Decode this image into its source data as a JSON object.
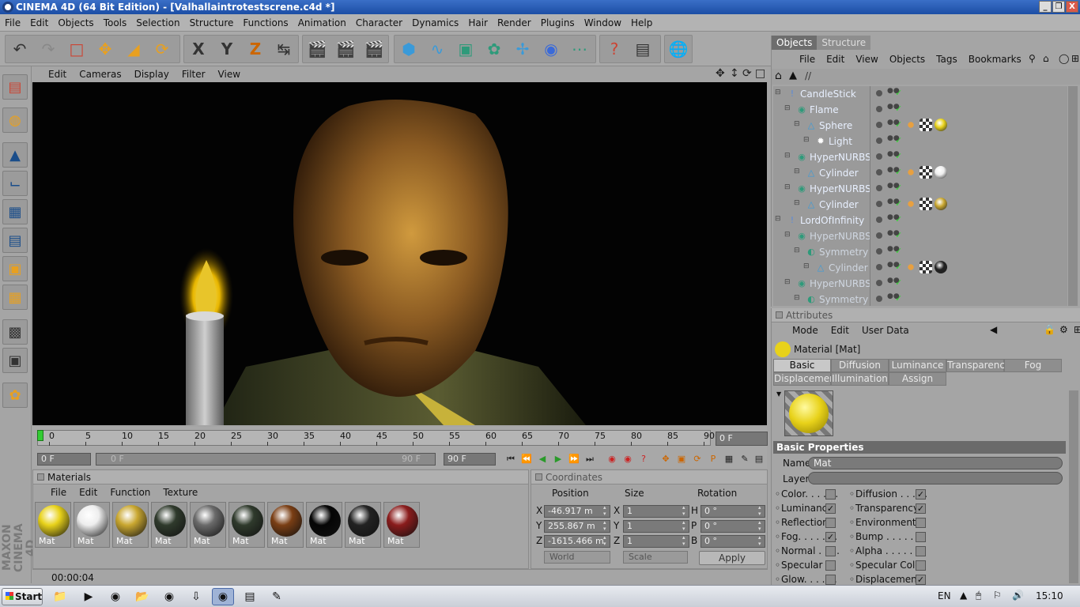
{
  "window": {
    "title": "CINEMA 4D (64 Bit Edition) - [Valhallaintrotestscrene.c4d *]",
    "min": "_",
    "restore": "❐",
    "close": "X"
  },
  "menu": [
    "File",
    "Edit",
    "Objects",
    "Tools",
    "Selection",
    "Structure",
    "Functions",
    "Animation",
    "Character",
    "Dynamics",
    "Hair",
    "Render",
    "Plugins",
    "Window",
    "Help"
  ],
  "toolbar": {
    "x_label": "X",
    "y_label": "Y",
    "z_label": "Z"
  },
  "viewport": {
    "menu": [
      "Edit",
      "Cameras",
      "Display",
      "Filter",
      "View"
    ]
  },
  "timeline": {
    "ticks": [
      "0",
      "5",
      "10",
      "15",
      "20",
      "25",
      "30",
      "35",
      "40",
      "45",
      "50",
      "55",
      "60",
      "65",
      "70",
      "75",
      "80",
      "85",
      "90"
    ],
    "current_frame": "0 F",
    "start_field": "0 F",
    "range_start": "0 F",
    "range_end": "90 F",
    "end_field": "90 F"
  },
  "materials": {
    "title": "Materials",
    "menu": [
      "File",
      "Edit",
      "Function",
      "Texture"
    ],
    "items": [
      {
        "label": "Mat",
        "color": "#e8d21a"
      },
      {
        "label": "Mat",
        "color": "#eeeeee"
      },
      {
        "label": "Mat",
        "color": "#c9a730"
      },
      {
        "label": "Mat",
        "color": "#2f3a2c"
      },
      {
        "label": "Mat",
        "color": "#6a6a6a"
      },
      {
        "label": "Mat",
        "color": "#2f3a2c"
      },
      {
        "label": "Mat",
        "color": "#7a3e14"
      },
      {
        "label": "Mat",
        "color": "#050505"
      },
      {
        "label": "Mat",
        "color": "#222222"
      },
      {
        "label": "Mat",
        "color": "#8a1c1c"
      }
    ]
  },
  "coordinates": {
    "title": "Coordinates",
    "headers": [
      "Position",
      "Size",
      "Rotation"
    ],
    "rows": [
      {
        "axis": "X",
        "pos": "-46.917 m",
        "saxis": "X",
        "size": "1",
        "raxis": "H",
        "rot": "0 °"
      },
      {
        "axis": "Y",
        "pos": "255.867 m",
        "saxis": "Y",
        "size": "1",
        "raxis": "P",
        "rot": "0 °"
      },
      {
        "axis": "Z",
        "pos": "-1615.466 m",
        "saxis": "Z",
        "size": "1",
        "raxis": "B",
        "rot": "0 °"
      }
    ],
    "mode": "World",
    "scale": "Scale",
    "apply": "Apply"
  },
  "status": {
    "time": "00:00:04"
  },
  "objects": {
    "tabs": [
      "Objects",
      "Structure"
    ],
    "menu": [
      "File",
      "Edit",
      "View",
      "Objects",
      "Tags",
      "Bookmarks"
    ],
    "path": "//",
    "rows": [
      {
        "name": "CandleStick",
        "indent": 0,
        "icon": "null",
        "dim": false,
        "tags": []
      },
      {
        "name": "Flame",
        "indent": 1,
        "icon": "nurbs",
        "dim": false,
        "tags": []
      },
      {
        "name": "Sphere",
        "indent": 2,
        "icon": "prim",
        "dim": false,
        "tags": [
          "#d48a2c",
          "#ffffff",
          "#e8d21a"
        ]
      },
      {
        "name": "Light",
        "indent": 3,
        "icon": "light",
        "dim": false,
        "tags": []
      },
      {
        "name": "HyperNURBS",
        "indent": 1,
        "icon": "nurbs",
        "dim": false,
        "tags": []
      },
      {
        "name": "Cylinder",
        "indent": 2,
        "icon": "prim",
        "dim": false,
        "tags": [
          "#d48a2c",
          "#ffffff",
          "#eeeeee"
        ]
      },
      {
        "name": "HyperNURBS",
        "indent": 1,
        "icon": "nurbs",
        "dim": false,
        "tags": []
      },
      {
        "name": "Cylinder",
        "indent": 2,
        "icon": "prim",
        "dim": false,
        "tags": [
          "#d48a2c",
          "#ffffff",
          "#c9a730"
        ]
      },
      {
        "name": "LordOfInfinity",
        "indent": 0,
        "icon": "null",
        "dim": false,
        "tags": []
      },
      {
        "name": "HyperNURBS",
        "indent": 1,
        "icon": "nurbs",
        "dim": true,
        "tags": []
      },
      {
        "name": "Symmetry",
        "indent": 2,
        "icon": "sym",
        "dim": true,
        "tags": []
      },
      {
        "name": "Cylinder",
        "indent": 3,
        "icon": "prim",
        "dim": true,
        "tags": [
          "#d48a2c",
          "#ffffff",
          "#222222"
        ]
      },
      {
        "name": "HyperNURBS",
        "indent": 1,
        "icon": "nurbs",
        "dim": true,
        "tags": []
      },
      {
        "name": "Symmetry",
        "indent": 2,
        "icon": "sym",
        "dim": true,
        "tags": []
      }
    ]
  },
  "attributes": {
    "title": "Attributes",
    "menu": [
      "Mode",
      "Edit",
      "User Data"
    ],
    "material_title": "Material [Mat]",
    "tabs_row1": [
      "Basic",
      "Diffusion",
      "Luminance",
      "Transparency",
      "Fog"
    ],
    "tabs_row2": [
      "Displacement",
      "Illumination",
      "Assign"
    ],
    "section": "Basic Properties",
    "name_label": "Name",
    "name_value": "Mat",
    "layer_label": "Layer",
    "props_left": [
      {
        "label": "Color. . . . . . ",
        "checked": false
      },
      {
        "label": "Luminance",
        "checked": true
      },
      {
        "label": "Reflection",
        "checked": false
      },
      {
        "label": "Fog. . . . . . . ",
        "checked": true
      },
      {
        "label": "Normal . . . . ",
        "checked": false
      },
      {
        "label": "Specular",
        "checked": false
      },
      {
        "label": "Glow. . . . . . ",
        "checked": false
      }
    ],
    "props_right": [
      {
        "label": "Diffusion . . . . . ",
        "checked": true
      },
      {
        "label": "Transparency",
        "checked": true
      },
      {
        "label": "Environment",
        "checked": false
      },
      {
        "label": "Bump . . . . . . . ",
        "checked": false
      },
      {
        "label": "Alpha . . . . . . . ",
        "checked": false
      },
      {
        "label": "Specular Color",
        "checked": false
      },
      {
        "label": "Displacement",
        "checked": true
      }
    ]
  },
  "taskbar": {
    "start": "Start",
    "lang": "EN",
    "clock": "15:10"
  },
  "logo": "MAXON CINEMA 4D"
}
